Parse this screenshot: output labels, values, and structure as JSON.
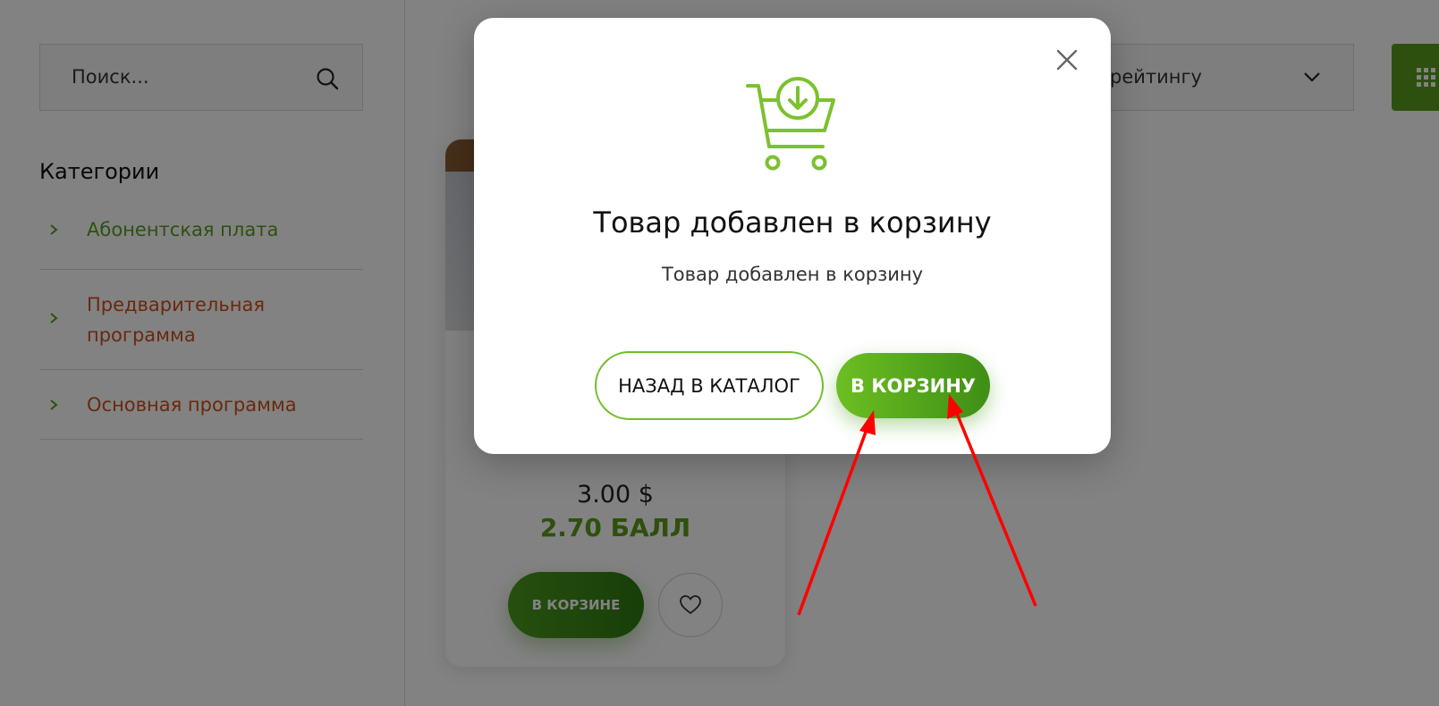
{
  "search": {
    "placeholder": "Поиск..."
  },
  "sidebar": {
    "title": "Категории",
    "categories": [
      {
        "label": "Абонентская плата"
      },
      {
        "label": "Предварительная программа"
      },
      {
        "label": "Основная программа"
      }
    ]
  },
  "sort": {
    "label": "рейтингу"
  },
  "product_card": {
    "price": "3.00 $",
    "points": "2.70 БАЛЛ",
    "cart_button_label": "В КОРЗИНЕ"
  },
  "modal": {
    "title": "Товар добавлен в корзину",
    "message": "Товар добавлен в корзину",
    "back_button_label": "НАЗАД В КАТАЛОГ",
    "cart_button_label": "В КОРЗИНУ"
  },
  "colors": {
    "accent_green": "#5a9e1d",
    "category_orange": "#d1501a",
    "annotation_red": "#ff0000"
  },
  "icons": [
    "search-icon",
    "chevron-right-icon",
    "chevron-down-icon",
    "grid-icon",
    "heart-icon",
    "close-icon",
    "cart-download-icon"
  ]
}
